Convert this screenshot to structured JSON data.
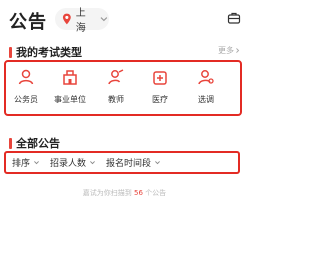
{
  "header": {
    "title": "公告",
    "city": "上海"
  },
  "exam_types": {
    "title": "我的考试类型",
    "more": "更多",
    "items": [
      {
        "label": "公务员",
        "icon": "person-icon"
      },
      {
        "label": "事业单位",
        "icon": "building-icon"
      },
      {
        "label": "教师",
        "icon": "teacher-icon"
      },
      {
        "label": "医疗",
        "icon": "medical-icon"
      },
      {
        "label": "选调",
        "icon": "transfer-icon"
      }
    ]
  },
  "announcements": {
    "title": "全部公告",
    "filters": [
      {
        "label": "排序"
      },
      {
        "label": "招录人数"
      },
      {
        "label": "报名时间段"
      }
    ],
    "result": {
      "prefix": "嘉试为你扫描到",
      "count": "56",
      "suffix": "个公告"
    }
  },
  "colors": {
    "accent": "#e8453c",
    "highlight_border": "#e32b24"
  }
}
